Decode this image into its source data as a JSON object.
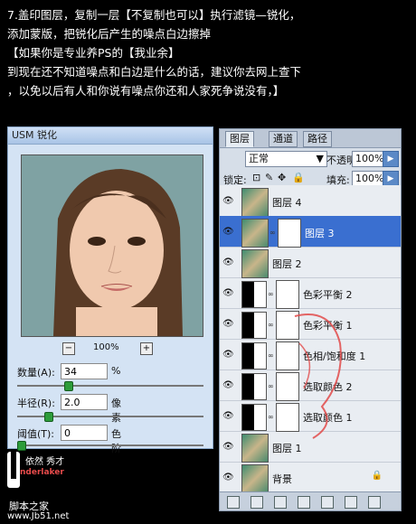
{
  "intro": {
    "line1": "7.盖印图层，复制一层【不复制也可以】执行滤镜—锐化，",
    "line2": "添加蒙版，把锐化后产生的噪点白边擦掉",
    "line3": "【如果你是专业养PS的【我业余】",
    "line4": "到现在还不知道噪点和白边是什么的话，建议你去网上查下",
    "line5": "，以免以后有人和你说有噪点你还和人家死争说没有，】"
  },
  "usm": {
    "title": "USM 锐化",
    "zoom": "100%",
    "amount_label": "数量(A):",
    "amount_value": "34",
    "amount_unit": "%",
    "radius_label": "半径(R):",
    "radius_value": "2.0",
    "radius_unit": "像素",
    "threshold_label": "阈值(T):",
    "threshold_value": "0",
    "threshold_unit": "色阶"
  },
  "layers": {
    "tabs": [
      "图层",
      "通道",
      "路径"
    ],
    "blend_mode": "正常",
    "opacity_label": "不透明度:",
    "opacity_value": "100%",
    "lock_label": "锁定:",
    "fill_label": "填充:",
    "fill_value": "100%",
    "items": [
      {
        "name": "图层 4",
        "kind": "photo",
        "selected": false
      },
      {
        "name": "图层 3",
        "kind": "photo-mask",
        "selected": true
      },
      {
        "name": "图层 2",
        "kind": "photo",
        "selected": false
      },
      {
        "name": "色彩平衡 2",
        "kind": "adjust",
        "selected": false
      },
      {
        "name": "色彩平衡 1",
        "kind": "adjust",
        "selected": false
      },
      {
        "name": "色相/饱和度 1",
        "kind": "adjust",
        "selected": false
      },
      {
        "name": "选取颜色 2",
        "kind": "adjust",
        "selected": false
      },
      {
        "name": "选取颜色 1",
        "kind": "adjust",
        "selected": false
      },
      {
        "name": "图层 1",
        "kind": "photo",
        "selected": false
      },
      {
        "name": "背景",
        "kind": "photo",
        "selected": false
      }
    ]
  },
  "watermark": {
    "author": "依然  秀才",
    "brand": "nderlaker",
    "site": "脚本之家",
    "url": "www.Jb51.net"
  },
  "colors": {
    "accent": "#3a6fd0",
    "background": "#000000"
  }
}
